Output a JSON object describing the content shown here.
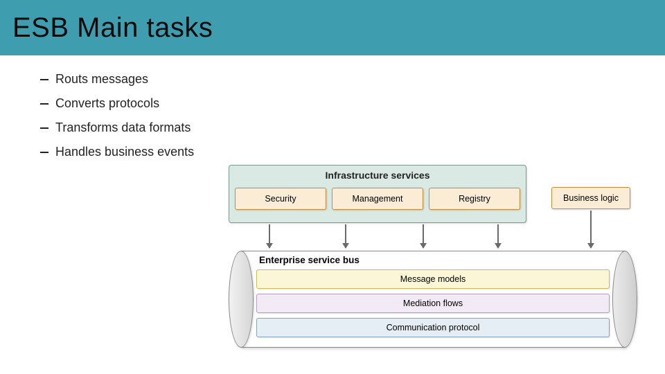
{
  "title": "ESB Main tasks",
  "bullets": [
    "Routs  messages",
    "Converts protocols",
    "Transforms data formats",
    "Handles business events"
  ],
  "diagram": {
    "infra_title": "Infrastructure services",
    "infra_items": [
      "Security",
      "Management",
      "Registry"
    ],
    "business_logic": "Business logic",
    "esb_title": "Enterprise service bus",
    "esb_rows": [
      "Message models",
      "Mediation flows",
      "Communication protocol"
    ]
  }
}
